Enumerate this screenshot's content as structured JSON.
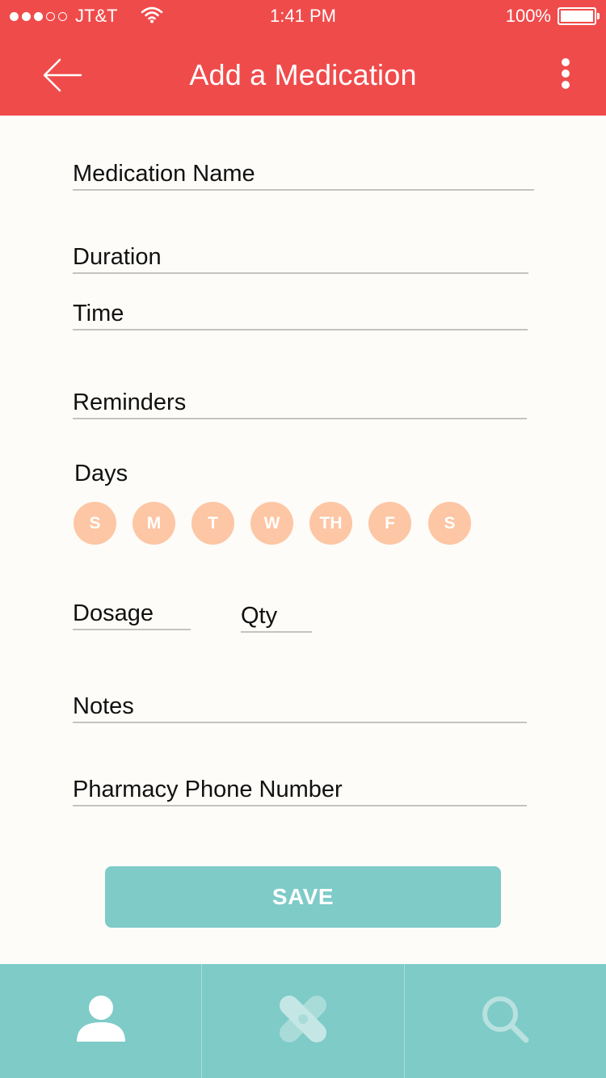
{
  "status_bar": {
    "carrier": "JT&T",
    "time": "1:41 PM",
    "battery": "100%",
    "signal_dots": [
      true,
      true,
      true,
      false,
      false
    ]
  },
  "header": {
    "title": "Add a Medication",
    "back_icon": "arrow-left-icon",
    "more_icon": "more-vertical-icon"
  },
  "form": {
    "medication_name": "Medication Name",
    "duration": "Duration",
    "time": "Time",
    "reminders": "Reminders",
    "days_label": "Days",
    "days": [
      "S",
      "M",
      "T",
      "W",
      "TH",
      "F",
      "S"
    ],
    "dosage": "Dosage",
    "qty": "Qty",
    "notes": "Notes",
    "pharmacy_phone": "Pharmacy Phone Number"
  },
  "save_label": "SAVE",
  "tabs": [
    {
      "icon": "person-icon"
    },
    {
      "icon": "bandage-icon"
    },
    {
      "icon": "search-icon"
    }
  ],
  "colors": {
    "header": "#f04b4b",
    "accent": "#7ecbc8",
    "day_circle": "#fdc6a4",
    "background": "#fdfcf8"
  }
}
